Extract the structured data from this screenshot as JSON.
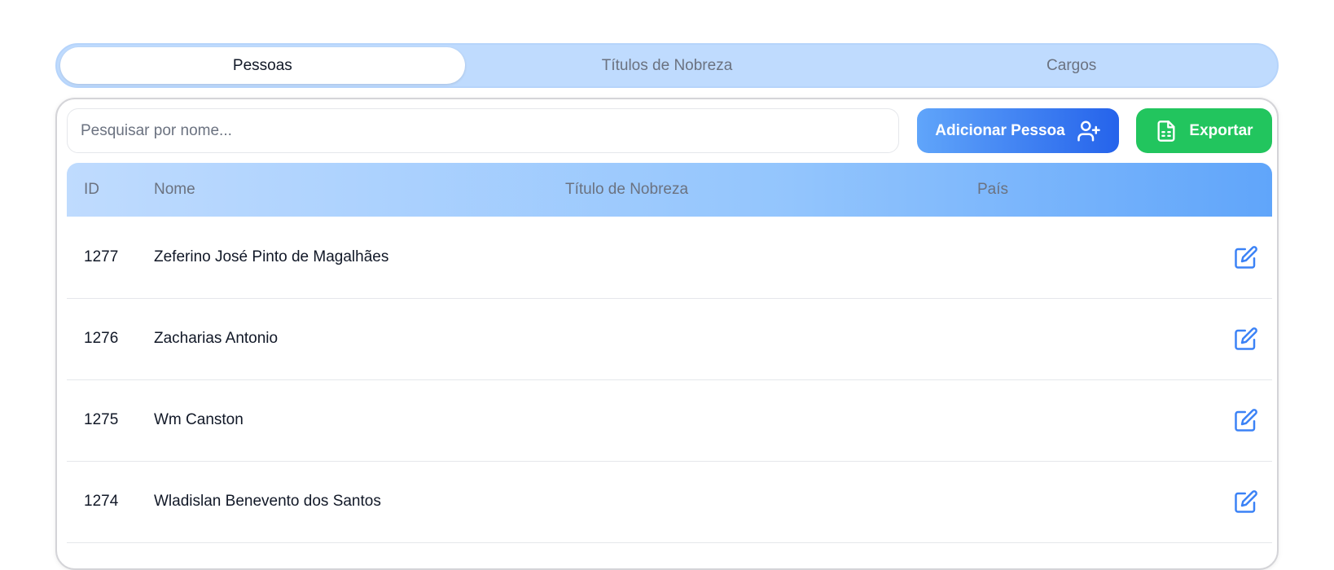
{
  "tabs": [
    {
      "label": "Pessoas",
      "active": true
    },
    {
      "label": "Títulos de Nobreza",
      "active": false
    },
    {
      "label": "Cargos",
      "active": false
    }
  ],
  "toolbar": {
    "search_placeholder": "Pesquisar por nome...",
    "search_value": "",
    "add_label": "Adicionar Pessoa",
    "add_icon": "user-plus-icon",
    "export_label": "Exportar",
    "export_icon": "spreadsheet-file-icon"
  },
  "table": {
    "headers": {
      "id": "ID",
      "name": "Nome",
      "title": "Título de Nobreza",
      "country": "País"
    },
    "rows": [
      {
        "id": "1277",
        "name": "Zeferino José Pinto de Magalhães",
        "title": "",
        "country": ""
      },
      {
        "id": "1276",
        "name": "Zacharias Antonio",
        "title": "",
        "country": ""
      },
      {
        "id": "1275",
        "name": "Wm Canston",
        "title": "",
        "country": ""
      },
      {
        "id": "1274",
        "name": "Wladislan Benevento dos Santos",
        "title": "",
        "country": ""
      }
    ],
    "row_action_icon": "edit-icon"
  },
  "colors": {
    "tab_bar": "#bfdbfe",
    "add_button_start": "#60a5fa",
    "add_button_end": "#2563eb",
    "export_button": "#22c55e",
    "edit_icon": "#3b82f6"
  }
}
